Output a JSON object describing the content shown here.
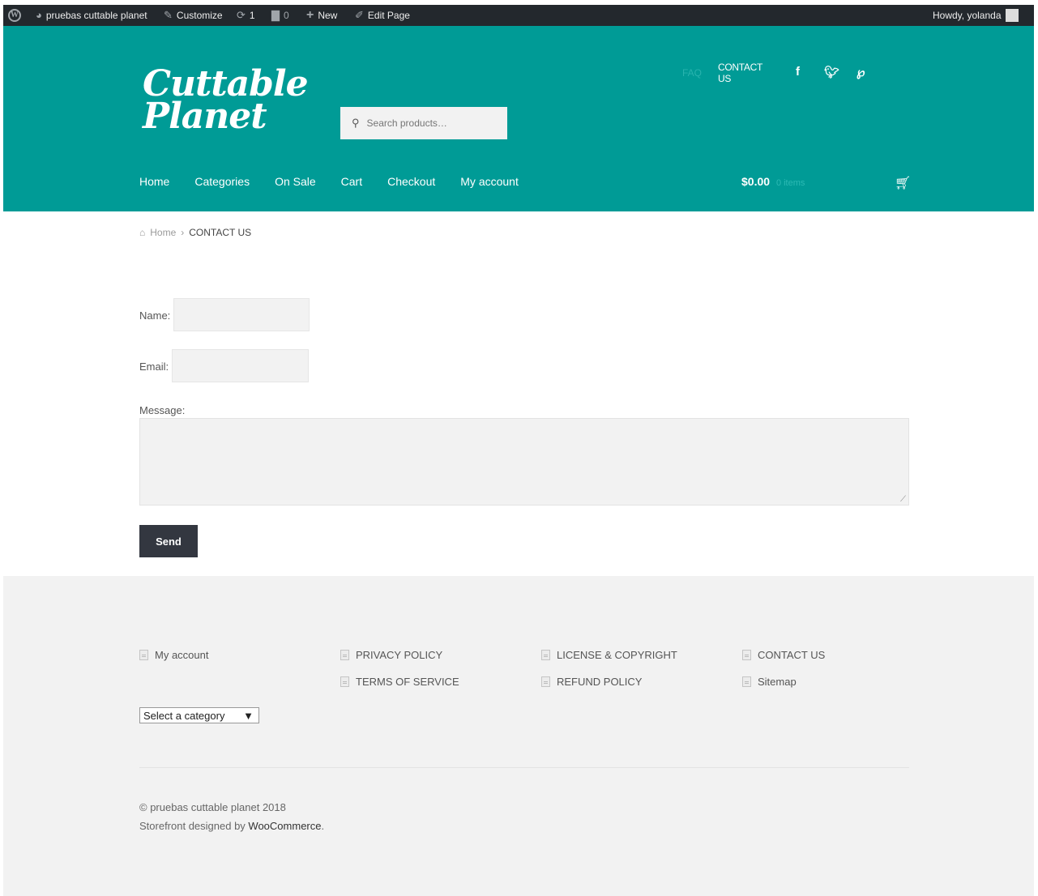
{
  "adminbar": {
    "site_name": "pruebas cuttable planet",
    "customize": "Customize",
    "updates_count": "1",
    "comments_count": "0",
    "new_label": "New",
    "edit_label": "Edit Page",
    "howdy": "Howdy, yolanda"
  },
  "header": {
    "logo_line1": "Cuttable",
    "logo_line2": "Planet",
    "search_placeholder": "Search products…",
    "secondary_nav": [
      "FAQ",
      "CONTACT US"
    ],
    "social_icons": [
      "facebook-icon",
      "twitter-icon",
      "pinterest-icon"
    ],
    "main_nav": [
      "Home",
      "Categories",
      "On Sale",
      "Cart",
      "Checkout",
      "My account"
    ],
    "cart_total": "$0.00",
    "cart_items": "0 items",
    "accent_color": "#009b96"
  },
  "breadcrumb": {
    "home": "Home",
    "current": "CONTACT US"
  },
  "form": {
    "name_label": "Name:",
    "email_label": "Email:",
    "message_label": "Message:",
    "send_label": "Send"
  },
  "footer": {
    "links_col1": [
      "My account"
    ],
    "links_col2": [
      "PRIVACY POLICY",
      "TERMS OF SERVICE"
    ],
    "links_col3": [
      "LICENSE & COPYRIGHT",
      "REFUND POLICY"
    ],
    "links_col4": [
      "CONTACT US",
      "Sitemap"
    ],
    "category_select": "Select a category",
    "copyright": "© pruebas cuttable planet 2018",
    "credit_prefix": "Storefront designed by ",
    "credit_link": "WooCommerce",
    "credit_suffix": "."
  }
}
